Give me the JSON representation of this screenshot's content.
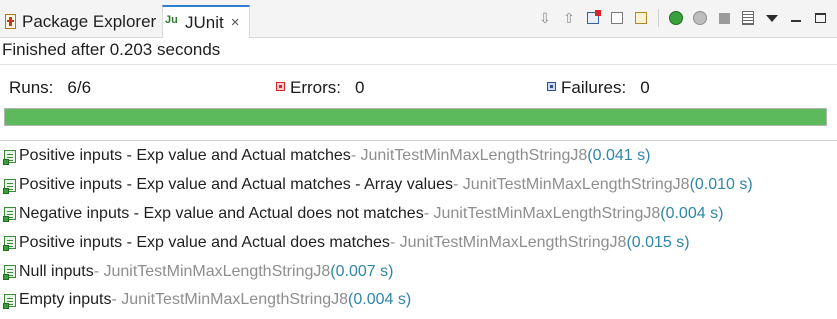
{
  "tabs": {
    "package_explorer": "Package Explorer",
    "junit": "JUnit",
    "close_glyph": "×"
  },
  "toolbar": {
    "items": [
      "next-failure",
      "previous-failure",
      "show-failures-only",
      "scroll-lock",
      "show-skipped",
      "rerun",
      "rerun-failures-first",
      "stop",
      "test-run-history",
      "view-menu",
      "minimize",
      "maximize"
    ]
  },
  "status": "Finished after 0.203 seconds",
  "counters": {
    "runs_label": "Runs:",
    "runs_value": "6/6",
    "errors_label": "Errors:",
    "errors_value": "0",
    "failures_label": "Failures:",
    "failures_value": "0"
  },
  "progress": {
    "fraction": 1.0,
    "color": "#5cba5c"
  },
  "tests": [
    {
      "name": "Positive inputs - Exp value and Actual matches",
      "class": " - JunitTestMinMaxLengthStringJ8",
      "time": " (0.041 s)"
    },
    {
      "name": "Positive inputs - Exp value and Actual matches - Array values",
      "class": " - JunitTestMinMaxLengthStringJ8",
      "time": " (0.010 s)"
    },
    {
      "name": "Negative inputs  - Exp value and Actual does not matches",
      "class": " - JunitTestMinMaxLengthStringJ8",
      "time": " (0.004 s)"
    },
    {
      "name": "Positive inputs  - Exp value and Actual does matches",
      "class": " - JunitTestMinMaxLengthStringJ8",
      "time": " (0.015 s)"
    },
    {
      "name": "Null inputs",
      "class": " - JunitTestMinMaxLengthStringJ8",
      "time": " (0.007 s)"
    },
    {
      "name": "Empty inputs",
      "class": " - JunitTestMinMaxLengthStringJ8",
      "time": " (0.004 s)"
    }
  ]
}
